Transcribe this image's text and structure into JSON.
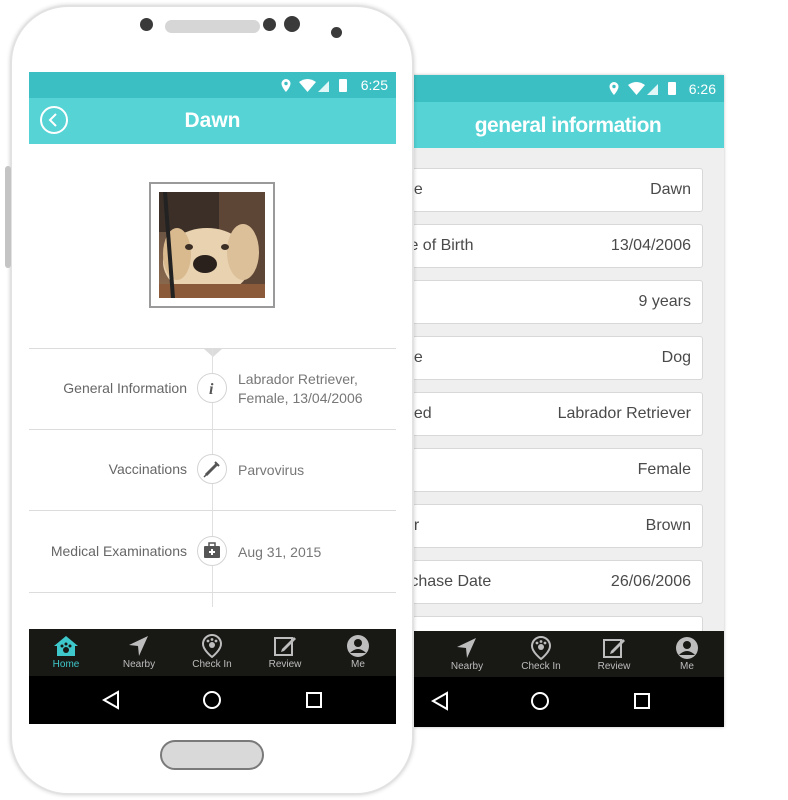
{
  "back_screen": {
    "status": {
      "time": "6:26"
    },
    "header": {
      "title": "general information"
    },
    "rows": [
      {
        "label": "ne",
        "value": "Dawn"
      },
      {
        "label": "te of Birth",
        "value": "13/04/2006"
      },
      {
        "label": "e",
        "value": "9 years"
      },
      {
        "label": "pe",
        "value": "Dog"
      },
      {
        "label": "eed",
        "value": "Labrador Retriever"
      },
      {
        "label": ":",
        "value": "Female"
      },
      {
        "label": "or",
        "value": "Brown"
      },
      {
        "label": "rchase Date",
        "value": "26/06/2006"
      }
    ],
    "tabs": [
      {
        "label": "Nearby",
        "icon": "navigation-arrow-icon"
      },
      {
        "label": "Check In",
        "icon": "paw-pin-icon"
      },
      {
        "label": "Review",
        "icon": "edit-icon"
      },
      {
        "label": "Me",
        "icon": "user-icon"
      }
    ]
  },
  "front_screen": {
    "status": {
      "time": "6:25"
    },
    "header": {
      "title": "Dawn"
    },
    "rows": [
      {
        "label": "General Information",
        "icon": "info-icon",
        "value_line1": "Labrador Retriever,",
        "value_line2": "Female, 13/04/2006"
      },
      {
        "label": "Vaccinations",
        "icon": "syringe-icon",
        "value_line1": "Parvovirus",
        "value_line2": ""
      },
      {
        "label": "Medical Examinations",
        "icon": "medical-kit-icon",
        "value_line1": "Aug 31, 2015",
        "value_line2": ""
      }
    ],
    "tabs": [
      {
        "label": "Home",
        "icon": "home-paw-icon",
        "active": true
      },
      {
        "label": "Nearby",
        "icon": "navigation-arrow-icon"
      },
      {
        "label": "Check In",
        "icon": "paw-pin-icon"
      },
      {
        "label": "Review",
        "icon": "edit-icon"
      },
      {
        "label": "Me",
        "icon": "user-icon"
      }
    ]
  },
  "colors": {
    "header": "#55d3d5",
    "status_bar": "#3bbfc3",
    "tab_active": "#3fc8cb",
    "tab_bar": "#181815"
  }
}
